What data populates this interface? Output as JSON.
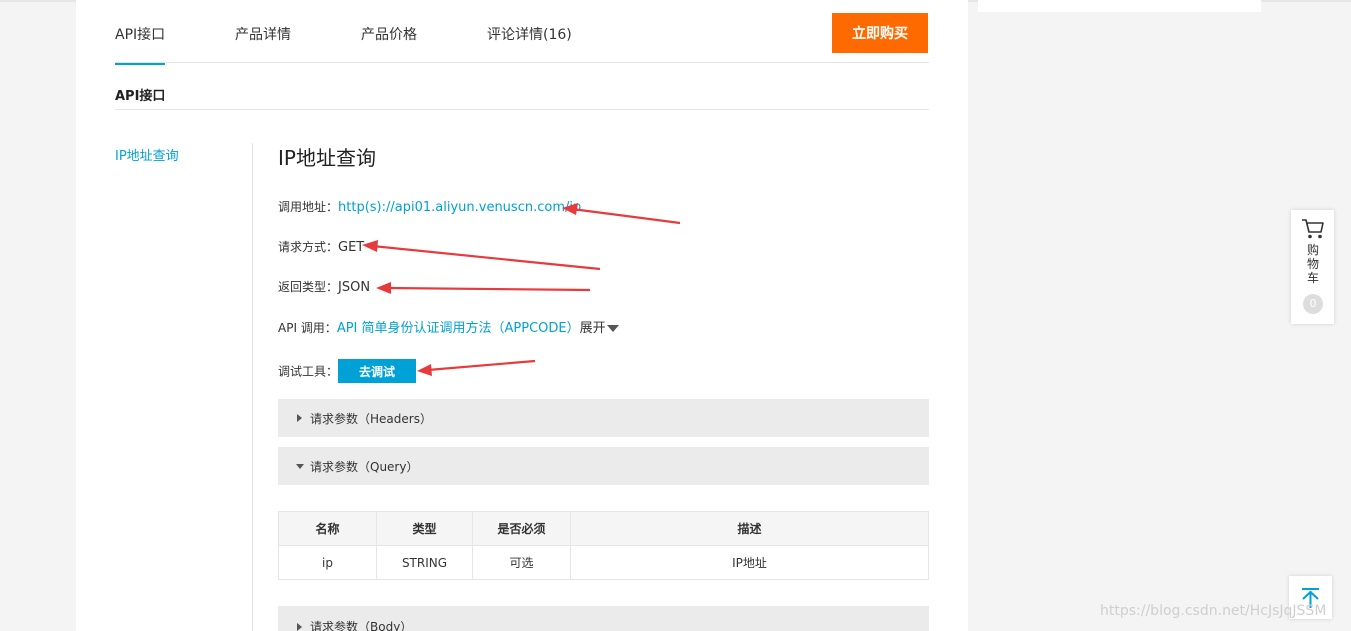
{
  "tabs": [
    {
      "label": "API接口",
      "active": true
    },
    {
      "label": "产品详情",
      "active": false
    },
    {
      "label": "产品价格",
      "active": false
    },
    {
      "label": "评论详情(16)",
      "active": false
    }
  ],
  "buy_button": "立即购买",
  "section_title": "API接口",
  "sidebar_link": "IP地址查询",
  "api": {
    "title": "IP地址查询",
    "url_label": "调用地址：",
    "url_value": "http(s)://api01.aliyun.venuscn.com/ip",
    "method_label": "请求方式：",
    "method_value": "GET",
    "return_label": "返回类型：",
    "return_value": "JSON",
    "call_label": "API 调用：",
    "call_link": "API 简单身份认证调用方法（APPCODE）",
    "call_expand": "展开",
    "debug_label": "调试工具：",
    "debug_button": "去调试"
  },
  "panels": {
    "headers": "请求参数（Headers）",
    "query": "请求参数（Query）",
    "body": "请求参数（Body）"
  },
  "table": {
    "headers": [
      "名称",
      "类型",
      "是否必须",
      "描述"
    ],
    "rows": [
      [
        "ip",
        "STRING",
        "可选",
        "IP地址"
      ]
    ]
  },
  "cart": {
    "label": "购物车",
    "count": "0"
  },
  "watermark": "https://blog.csdn.net/HcJsJqJSSM",
  "colors": {
    "accent": "#00a1d6",
    "buy": "#ff6a00",
    "annotation": "#e8393b"
  },
  "icons": {
    "cart": "cart-icon",
    "back_to_top": "arrow-up-icon"
  }
}
